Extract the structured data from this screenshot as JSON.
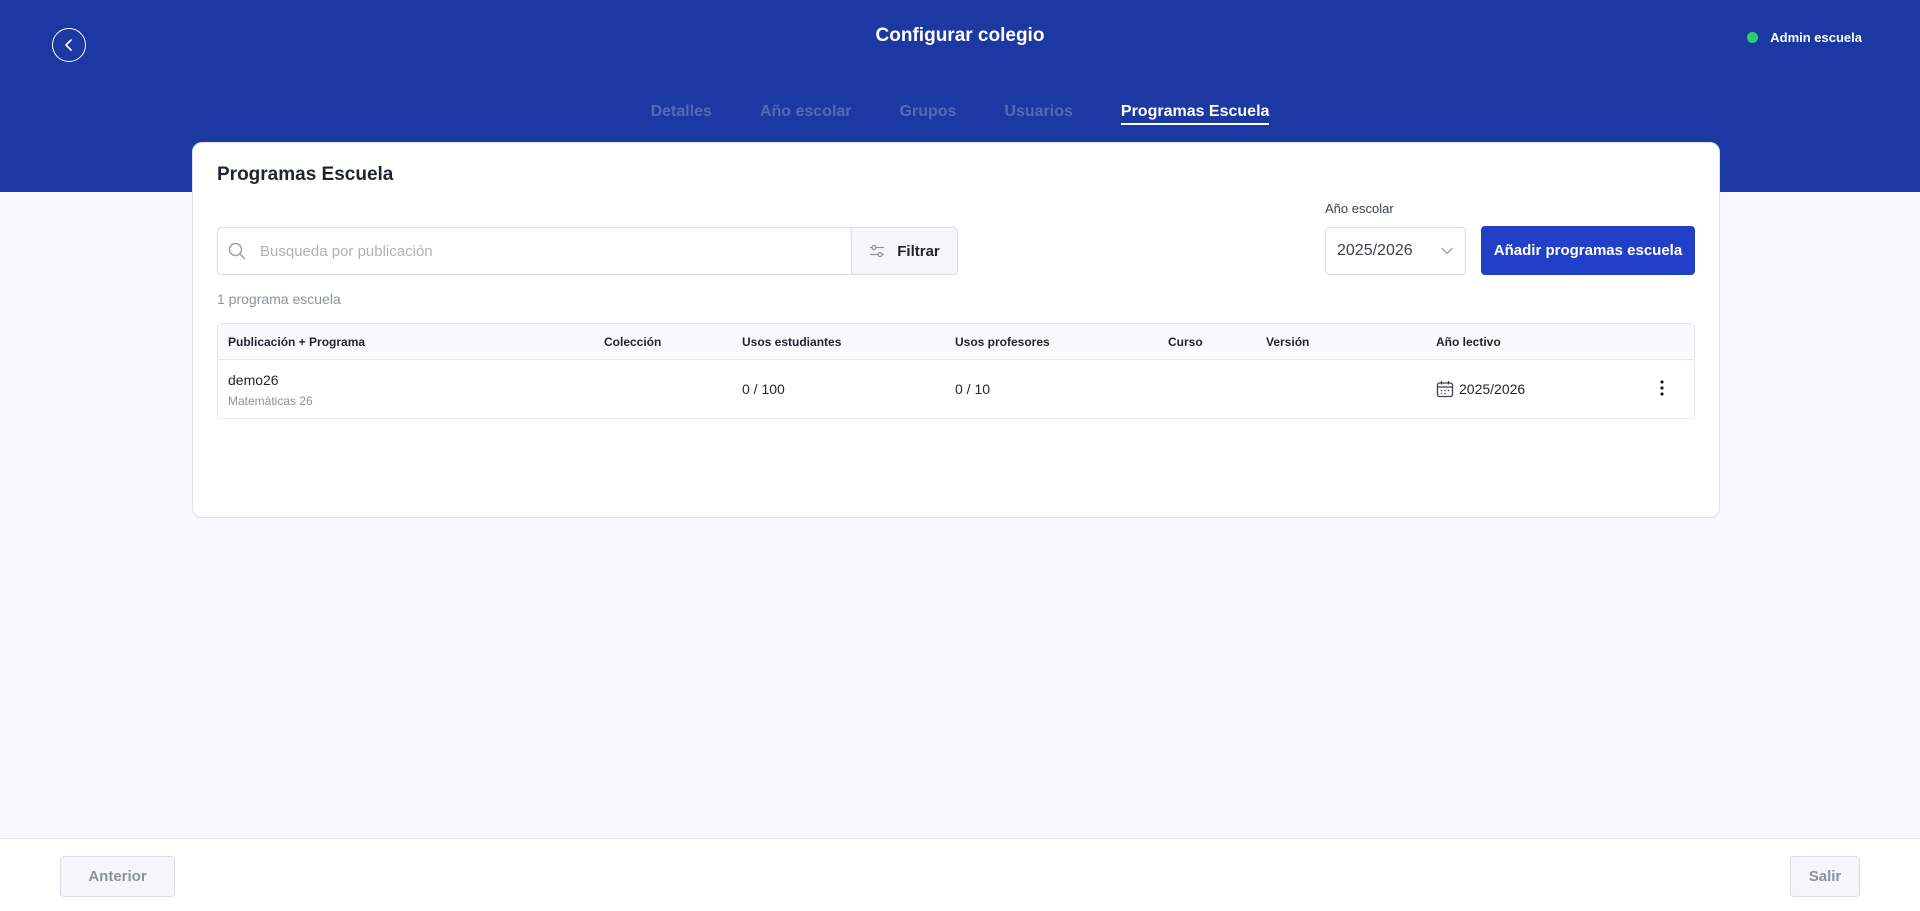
{
  "header": {
    "title": "Configurar colegio",
    "user_status": "Admin escuela",
    "status_color": "#2ecc71",
    "back_icon": "chevron-left-icon"
  },
  "tabs": [
    {
      "label": "Detalles",
      "active": false
    },
    {
      "label": "Año escolar",
      "active": false
    },
    {
      "label": "Grupos",
      "active": false
    },
    {
      "label": "Usuarios",
      "active": false
    },
    {
      "label": "Programas Escuela",
      "active": true
    }
  ],
  "card": {
    "title": "Programas Escuela",
    "search": {
      "placeholder": "Busqueda por publicación",
      "value": ""
    },
    "filter_label": "Filtrar",
    "year_label": "Año escolar",
    "year_value": "2025/2026",
    "add_button": "Añadir programas escuela",
    "count_text": "1 programa escuela"
  },
  "table": {
    "columns": [
      "Publicación + Programa",
      "Colección",
      "Usos estudiantes",
      "Usos profesores",
      "Curso",
      "Versión",
      "Año lectivo"
    ],
    "rows": [
      {
        "publication": "demo26",
        "program": "Matemáticas 26",
        "collection": "",
        "student_uses": "0 / 100",
        "teacher_uses": "0 / 10",
        "course": "",
        "version": "",
        "year": "2025/2026"
      }
    ]
  },
  "footer": {
    "prev_label": "Anterior",
    "exit_label": "Salir"
  },
  "colors": {
    "header_bg": "#1c38a3",
    "primary_button": "#2140c7",
    "page_bg": "#f7f8fc"
  }
}
